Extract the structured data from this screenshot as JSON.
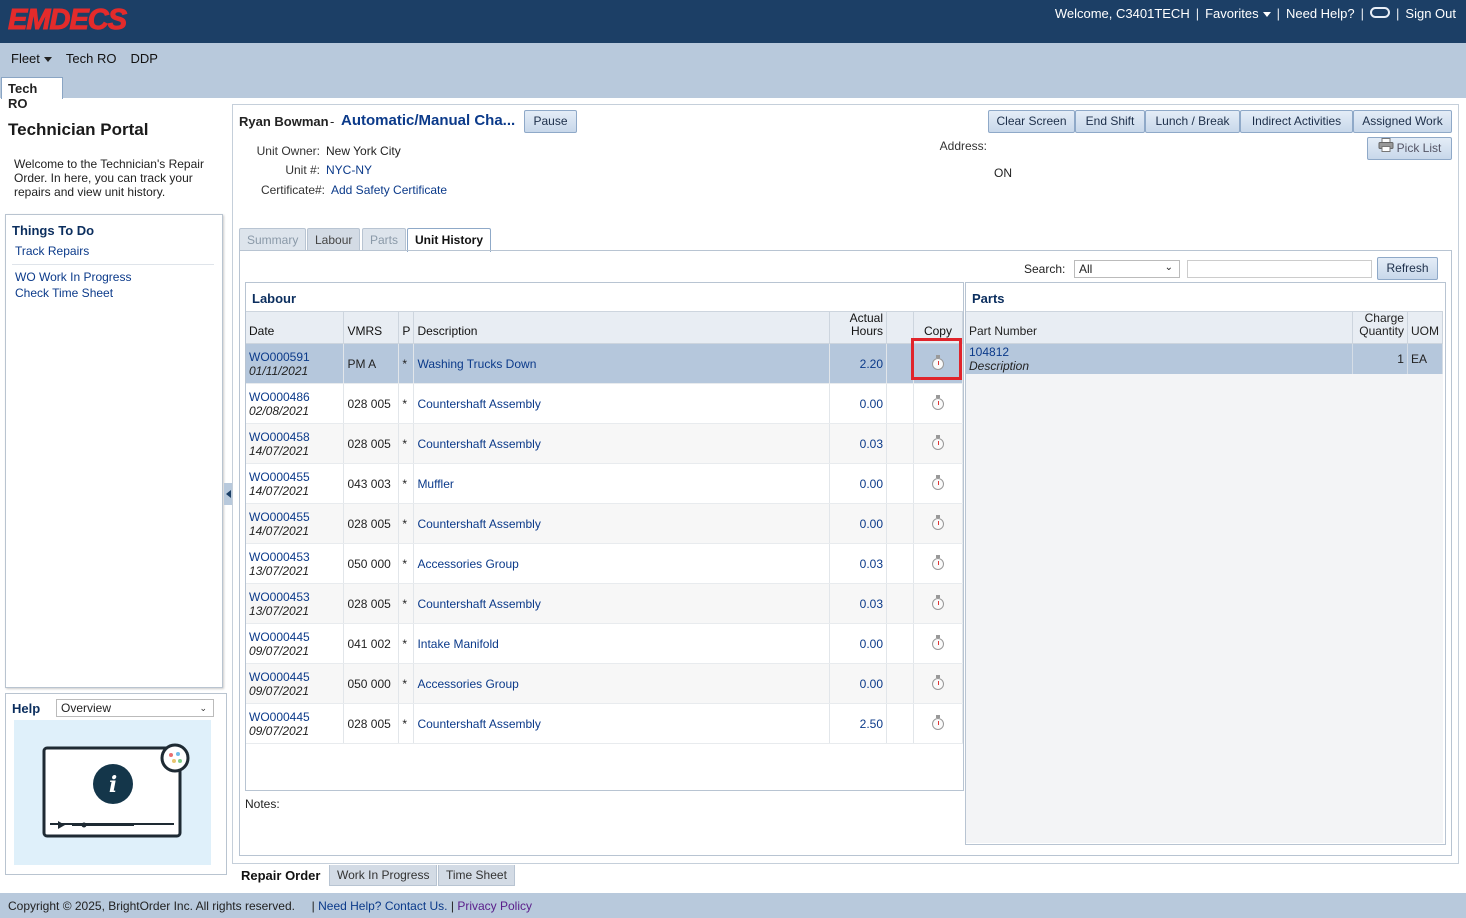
{
  "header": {
    "logo": "EMDECS",
    "welcome": "Welcome, C3401TECH",
    "favorites": "Favorites",
    "need_help": "Need Help?",
    "sign_out": "Sign Out",
    "separator": "|"
  },
  "menu": {
    "fleet": "Fleet",
    "tech_ro": "Tech RO",
    "ddp": "DDP"
  },
  "page_tab": "Tech RO",
  "left": {
    "title": "Technician Portal",
    "welcome": "Welcome to the Technician's Repair Order. In here, you can track your repairs and view unit history.",
    "things_title": "Things To Do",
    "items": [
      "Track Repairs",
      "WO Work In Progress",
      "Check Time Sheet"
    ],
    "help_label": "Help",
    "help_option": "Overview"
  },
  "job": {
    "technician": "Ryan Bowman",
    "dash": "-",
    "title": "Automatic/Manual Cha...",
    "pause": "Pause",
    "unit_owner_label": "Unit Owner:",
    "unit_owner": "New York City",
    "unit_label": "Unit #:",
    "unit": "NYC-NY",
    "cert_label": "Certificate#:",
    "cert": "Add Safety Certificate",
    "address_label": "Address:",
    "address_province": "ON"
  },
  "actions": {
    "clear_screen": "Clear Screen",
    "end_shift": "End Shift",
    "lunch_break": "Lunch / Break",
    "indirect": "Indirect Activities",
    "assigned": "Assigned Work",
    "pick_list": "Pick List"
  },
  "tabs": [
    "Summary",
    "Labour",
    "Parts",
    "Unit History"
  ],
  "search": {
    "label": "Search:",
    "option": "All",
    "refresh": "Refresh"
  },
  "labour": {
    "title": "Labour",
    "columns": {
      "date": "Date",
      "vmrs": "VMRS",
      "p": "P",
      "description": "Description",
      "hours": "Actual Hours",
      "copy": "Copy"
    },
    "rows": [
      {
        "wo": "WO000591",
        "date": "01/11/2021",
        "vmrs": "PM A",
        "p": "*",
        "desc": "Washing Trucks Down",
        "hours": "2.20"
      },
      {
        "wo": "WO000486",
        "date": "02/08/2021",
        "vmrs": "028 005",
        "p": "*",
        "desc": "Countershaft Assembly",
        "hours": "0.00"
      },
      {
        "wo": "WO000458",
        "date": "14/07/2021",
        "vmrs": "028 005",
        "p": "*",
        "desc": "Countershaft Assembly",
        "hours": "0.03"
      },
      {
        "wo": "WO000455",
        "date": "14/07/2021",
        "vmrs": "043 003",
        "p": "*",
        "desc": "Muffler",
        "hours": "0.00"
      },
      {
        "wo": "WO000455",
        "date": "14/07/2021",
        "vmrs": "028 005",
        "p": "*",
        "desc": "Countershaft Assembly",
        "hours": "0.00"
      },
      {
        "wo": "WO000453",
        "date": "13/07/2021",
        "vmrs": "050 000",
        "p": "*",
        "desc": "Accessories Group",
        "hours": "0.03"
      },
      {
        "wo": "WO000453",
        "date": "13/07/2021",
        "vmrs": "028 005",
        "p": "*",
        "desc": "Countershaft Assembly",
        "hours": "0.03"
      },
      {
        "wo": "WO000445",
        "date": "09/07/2021",
        "vmrs": "041 002",
        "p": "*",
        "desc": "Intake Manifold",
        "hours": "0.00"
      },
      {
        "wo": "WO000445",
        "date": "09/07/2021",
        "vmrs": "050 000",
        "p": "*",
        "desc": "Accessories Group",
        "hours": "0.00"
      },
      {
        "wo": "WO000445",
        "date": "09/07/2021",
        "vmrs": "028 005",
        "p": "*",
        "desc": "Countershaft Assembly",
        "hours": "2.50"
      }
    ]
  },
  "notes_label": "Notes:",
  "parts": {
    "title": "Parts",
    "columns": {
      "part": "Part Number",
      "qty": "Charge Quantity",
      "uom": "UOM"
    },
    "rows": [
      {
        "part": "104812",
        "desc": "Description",
        "qty": "1",
        "uom": "EA"
      }
    ]
  },
  "bottom_tabs": [
    "Repair Order",
    "Work In Progress",
    "Time Sheet"
  ],
  "footer": {
    "copyright": "Copyright © 2025, BrightOrder Inc. All rights reserved.",
    "sep": "|",
    "help": "Need Help? Contact Us.",
    "privacy": "Privacy Policy"
  }
}
